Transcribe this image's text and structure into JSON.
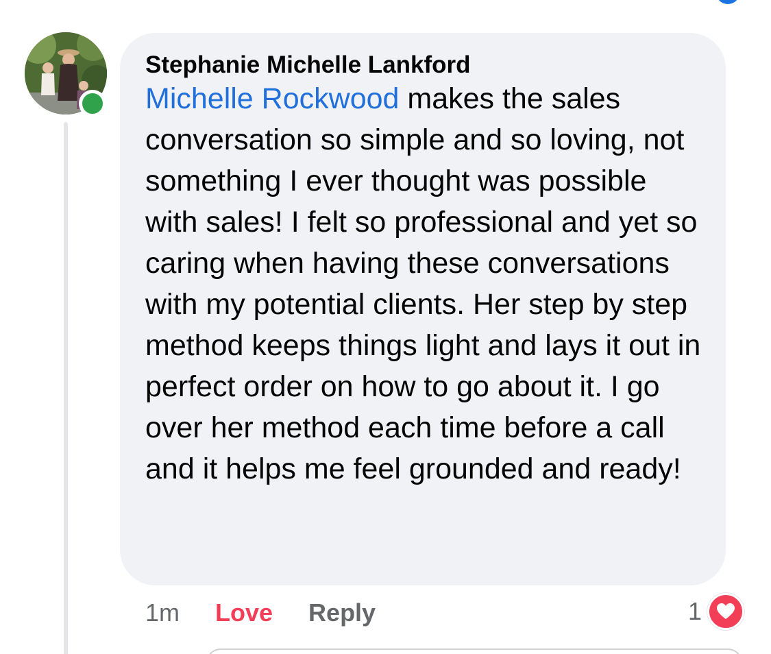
{
  "comment": {
    "author": "Stephanie Michelle Lankford",
    "mention": "Michelle Rockwood",
    "text_after_mention": " makes the sales conversation so simple and so loving, not something I ever thought was possible with sales! I felt so professional and yet so caring when having these conversations with my potential clients. Her step by step method keeps things light and lays it out in perfect order on how to go about it. I go over her method each time before a call and it helps me feel grounded and ready!",
    "online": true,
    "timestamp": "1m",
    "love_label": "Love",
    "reply_label": "Reply",
    "reaction_count": "1",
    "reaction_type": "heart-icon"
  },
  "colors": {
    "bubble_bg": "#f0f2f5",
    "mention": "#216fdb",
    "love": "#f33e58",
    "online": "#31a24c",
    "secondary_text": "#65676b"
  }
}
